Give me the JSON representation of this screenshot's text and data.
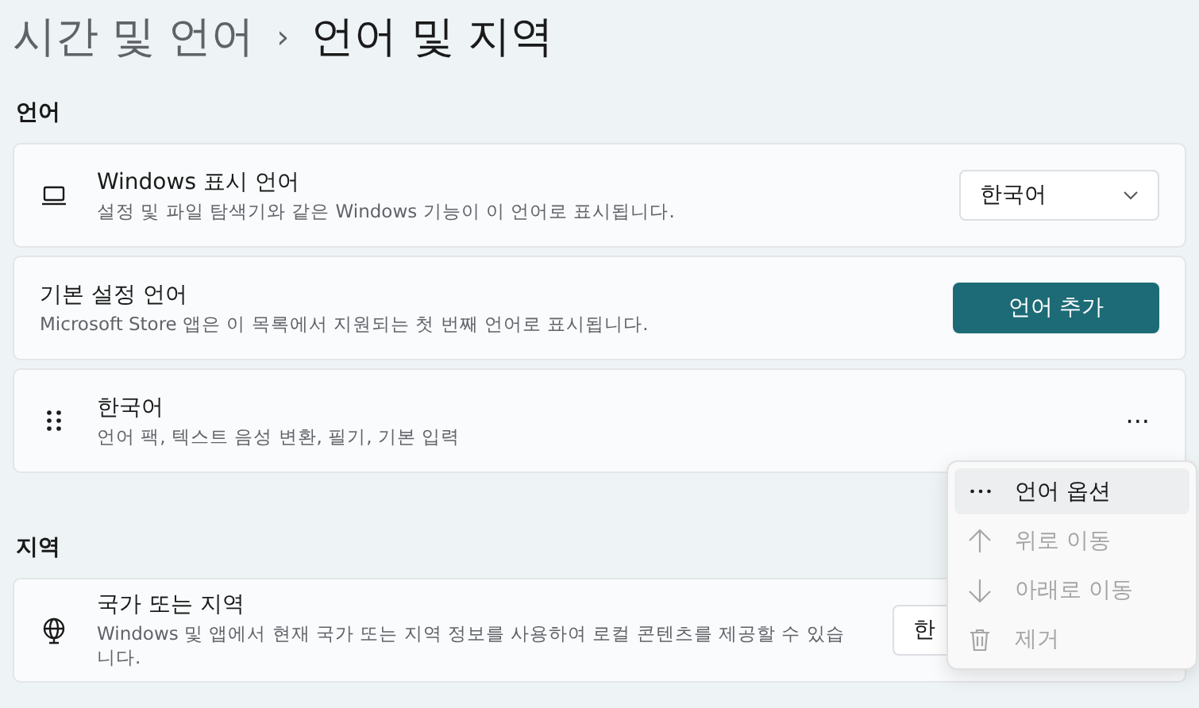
{
  "breadcrumb": {
    "parent": "시간 및 언어",
    "separator": "›",
    "current": "언어 및 지역"
  },
  "sections": [
    {
      "title": "언어",
      "cards": [
        {
          "kind": "dropdown",
          "title": "Windows 표시 언어",
          "description": "설정 및 파일 탐색기와 같은 Windows 기능이 이 언어로 표시됩니다.",
          "value": "한국어"
        },
        {
          "kind": "button",
          "title": "기본 설정 언어",
          "description": "Microsoft Store 앱은 이 목록에서 지원되는 첫 번째 언어로 표시됩니다.",
          "button": "언어 추가"
        },
        {
          "kind": "more",
          "title": "한국어",
          "description": "언어 팩, 텍스트 음성 변환, 필기, 기본 입력",
          "more": "···"
        }
      ]
    },
    {
      "title": "지역",
      "cards": [
        {
          "kind": "dropdown",
          "title": "국가 또는 지역",
          "description": "Windows 및 앱에서 현재 국가 또는 지역 정보를 사용하여 로컬 콘텐츠를 제공할 수 있습니다.",
          "value": "한"
        }
      ]
    }
  ],
  "context_menu": {
    "items": [
      {
        "label": "언어 옵션",
        "disabled": false,
        "selected": true
      },
      {
        "label": "위로 이동",
        "disabled": true,
        "selected": false
      },
      {
        "label": "아래로 이동",
        "disabled": true,
        "selected": false
      },
      {
        "label": "제거",
        "disabled": true,
        "selected": false
      }
    ]
  }
}
